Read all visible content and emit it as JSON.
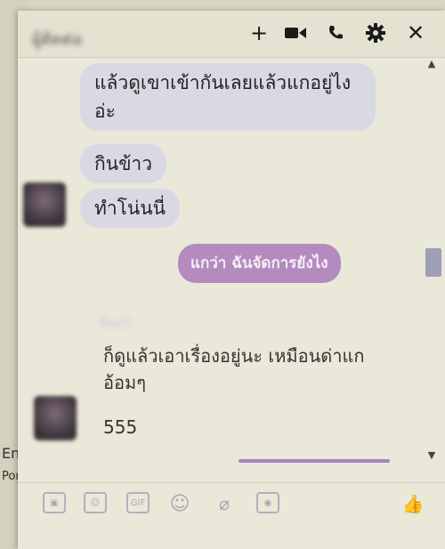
{
  "header": {
    "contact_name": "ผู้ติดต่อ",
    "add_icon": "+",
    "close_icon": "✕"
  },
  "messages": {
    "m1": "แล้วดูเขาเข้ากันเลยแล้วแกอยู่ไงอ่ะ",
    "m2": "กินข้าว",
    "m3": "ทำโน่นนี่",
    "m4_mine": "แกว่า ฉันจัดการยังไง",
    "sender2": "Nuch",
    "m5": "ก็ดูแล้วเอาเรื่องอยู่นะ เหมือนด่าแกอ้อมๆ",
    "m6": "555"
  },
  "background_fragments": [
    "En",
    "Por"
  ],
  "composer_tools": [
    "photo-icon",
    "sticker-icon",
    "gif-icon",
    "emoji-icon",
    "attach-icon",
    "camera-icon",
    "like-icon"
  ],
  "colors": {
    "window_bg": "#e9e8d9",
    "incoming_bubble": "#d9d9e3",
    "outgoing_bubble": "#b38bbf",
    "accent": "#a783c2"
  }
}
